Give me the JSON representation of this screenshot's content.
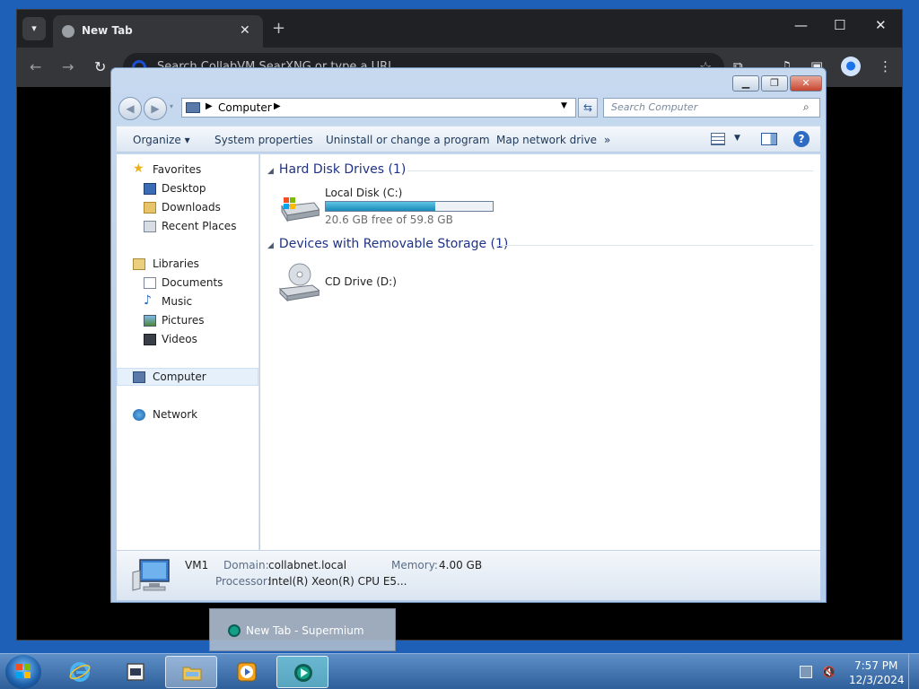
{
  "browser": {
    "tab_title": "New Tab",
    "tab_close": "✕",
    "new_tab": "+",
    "omnibox_placeholder": "Search CollabVM SearXNG or type a URL",
    "controls": {
      "minimize": "—",
      "maximize": "☐",
      "close": "✕"
    }
  },
  "explorer": {
    "breadcrumb": "Computer",
    "search_placeholder": "Search Computer",
    "commands": [
      "Organize",
      "System properties",
      "Uninstall or change a program",
      "Map network drive"
    ],
    "more_commands": "»",
    "nav": {
      "favorites": {
        "label": "Favorites",
        "items": [
          "Desktop",
          "Downloads",
          "Recent Places"
        ]
      },
      "libraries": {
        "label": "Libraries",
        "items": [
          "Documents",
          "Music",
          "Pictures",
          "Videos"
        ]
      },
      "computer": "Computer",
      "network": "Network"
    },
    "groups": {
      "hdd": {
        "title": "Hard Disk Drives (1)"
      },
      "removable": {
        "title": "Devices with Removable Storage (1)"
      }
    },
    "drives": {
      "c": {
        "name": "Local Disk (C:)",
        "free_text": "20.6 GB free of 59.8 GB",
        "used_fraction": 0.656
      },
      "d": {
        "name": "CD Drive (D:)"
      }
    },
    "details": {
      "name": "VM1",
      "domain_label": "Domain:",
      "domain_value": "collabnet.local",
      "memory_label": "Memory:",
      "memory_value": "4.00 GB",
      "processor_label": "Processor:",
      "processor_value": "Intel(R) Xeon(R) CPU E5..."
    }
  },
  "taskbar": {
    "preview_title": "New Tab - Supermium",
    "time": "7:57 PM",
    "date": "12/3/2024",
    "colors": {
      "accent": "#2f5f9a",
      "drive_fill": "#1a8ab8"
    }
  }
}
